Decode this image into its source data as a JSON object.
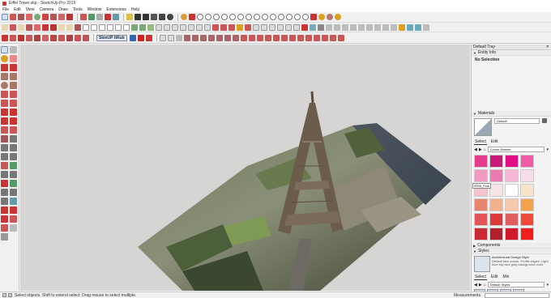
{
  "window": {
    "title": "Eiffel Tower.skp - SketchUp Pro 2019"
  },
  "menu": [
    "File",
    "Edit",
    "View",
    "Camera",
    "Draw",
    "Tools",
    "Window",
    "Extensions",
    "Help"
  ],
  "toolbar": {
    "extension_label": "SkinUP ItRub"
  },
  "tray": {
    "title": "Default Tray",
    "entity_info": {
      "label": "Entity Info",
      "selection": "No Selection"
    },
    "materials": {
      "label": "Materials",
      "name": "Default",
      "tabs": [
        "Select",
        "Edit"
      ],
      "library": "Colors-Named",
      "swatch_label": "0008_Pink"
    },
    "components": {
      "label": "Components"
    },
    "styles": {
      "label": "Styles",
      "style_name": "Architectural Design Style",
      "style_desc": "Default face colors. Profile edges. Light blue sky and gray background color.",
      "tabs": [
        "Select",
        "Edit",
        "Mix"
      ],
      "library": "Default Styles"
    },
    "swatch_colors": [
      "#e43c8c",
      "#c7197a",
      "#e20d86",
      "#ef5ba6",
      "#f09cc0",
      "#ea7bb0",
      "#f7b7d4",
      "#f6dce9",
      "#f5c4cf",
      "#f8e3e7",
      "#ffffff",
      "#f7e4c9",
      "#e8856e",
      "#f2b18c",
      "#f6c9ad",
      "#f3a24a",
      "#e4555b",
      "#dc3a3a",
      "#e25d5d",
      "#f04a3a",
      "#c92b36",
      "#b21f2d",
      "#d2182b",
      "#f21d1d"
    ]
  },
  "status": {
    "hint": "Select objects. Shift to extend select. Drag mouse to select multiple.",
    "measurements_label": "Measurements"
  }
}
